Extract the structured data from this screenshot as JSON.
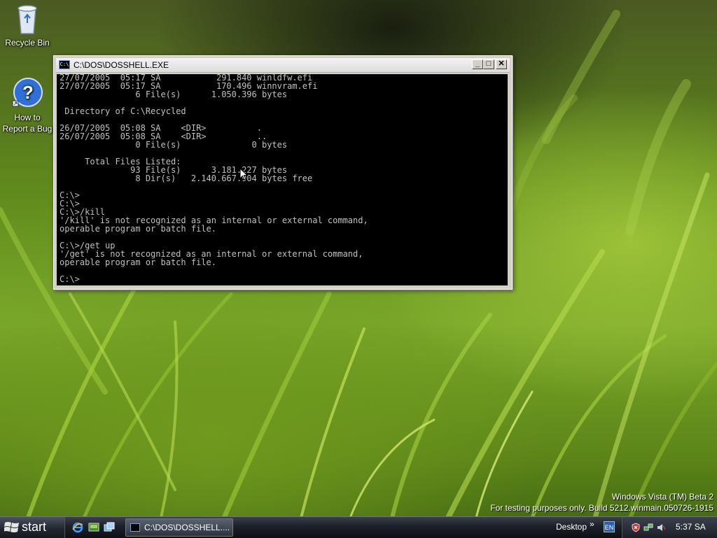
{
  "desktop": {
    "icons": [
      {
        "label": "Recycle Bin",
        "icon": "recycle-bin-icon"
      },
      {
        "label": "How to Report a Bug",
        "icon": "help-icon"
      }
    ],
    "watermark": {
      "line1": "Windows Vista (TM) Beta 2",
      "line2": "For testing purposes only. Build 5212.winmain.050726-1915"
    }
  },
  "console": {
    "title": "C:\\DOS\\DOSSHELL.EXE",
    "minimize_label": "_",
    "maximize_label": "□",
    "close_label": "✕",
    "output": "27/07/2005  05:17 SA           291.840 winldfw.efi\n27/07/2005  05:17 SA           170.496 winnvram.efi\n               6 File(s)      1.050.396 bytes\n\n Directory of C:\\Recycled\n\n26/07/2005  05:08 SA    <DIR>          .\n26/07/2005  05:08 SA    <DIR>          ..\n               0 File(s)              0 bytes\n\n     Total Files Listed:\n              93 File(s)      3.181.227 bytes\n               8 Dir(s)   2.140.667.904 bytes free\n\nC:\\>\nC:\\>\nC:\\>/kill\n'/kill' is not recognized as an internal or external command,\noperable program or batch file.\n\nC:\\>/get up\n'/get' is not recognized as an internal or external command,\noperable program or batch file.\n\nC:\\>"
  },
  "taskbar": {
    "start_label": "start",
    "quick_launch": [
      "ie-icon",
      "show-desktop-icon",
      "switch-windows-icon"
    ],
    "task_button_label": "C:\\DOS\\DOSSHELL....",
    "desktop_toolbar_label": "Desktop",
    "chevron": "»",
    "language": "EN",
    "clock": "5:37 SA"
  },
  "colors": {
    "console_bg": "#000000",
    "console_text": "#c0c0c0",
    "taskbar_bg": "#1c2028"
  }
}
